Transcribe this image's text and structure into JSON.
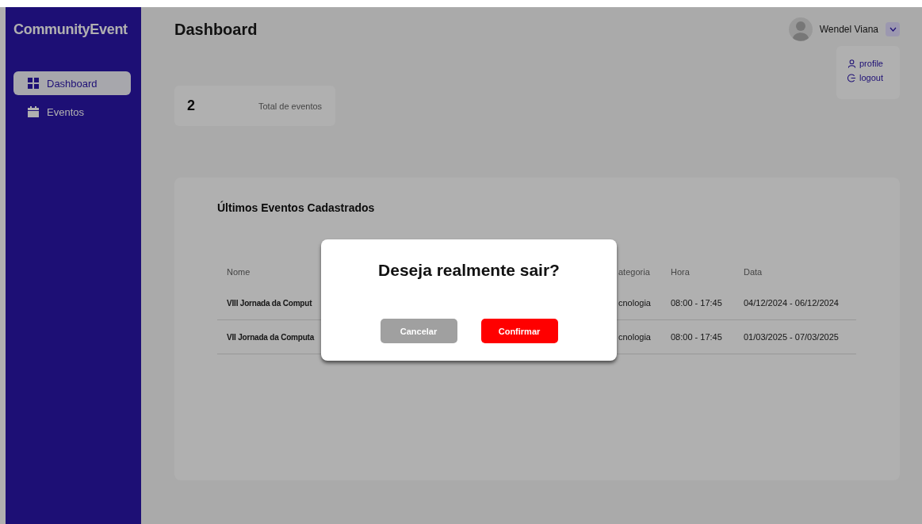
{
  "sidebar": {
    "brand": "CommunityEvent",
    "items": [
      {
        "label": "Dashboard",
        "selected": true
      },
      {
        "label": "Eventos",
        "selected": false
      }
    ]
  },
  "header": {
    "title": "Dashboard",
    "user": {
      "name": "Wendel Viana"
    },
    "user_menu": {
      "expanded": true,
      "items": [
        {
          "label": "profile"
        },
        {
          "label": "logout"
        }
      ]
    }
  },
  "stats": [
    {
      "value": "2",
      "label": "Total de eventos"
    }
  ],
  "recent_events": {
    "title": "Últimos Eventos Cadastrados",
    "columns": [
      "Nome",
      "ategoria",
      "Hora",
      "Data"
    ],
    "rows": [
      [
        "VIII Jornada da Comput",
        "cnologia",
        "08:00 - 17:45",
        "04/12/2024 - 06/12/2024"
      ],
      [
        "VII Jornada da Computa",
        "cnologia",
        "08:00 - 17:45",
        "01/03/2025 - 07/03/2025"
      ]
    ]
  },
  "dialog": {
    "title": "Deseja realmente sair?",
    "buttons": [
      {
        "label": "Cancelar",
        "kind": "secondary"
      },
      {
        "label": "Confirmar",
        "kind": "primary"
      }
    ]
  }
}
